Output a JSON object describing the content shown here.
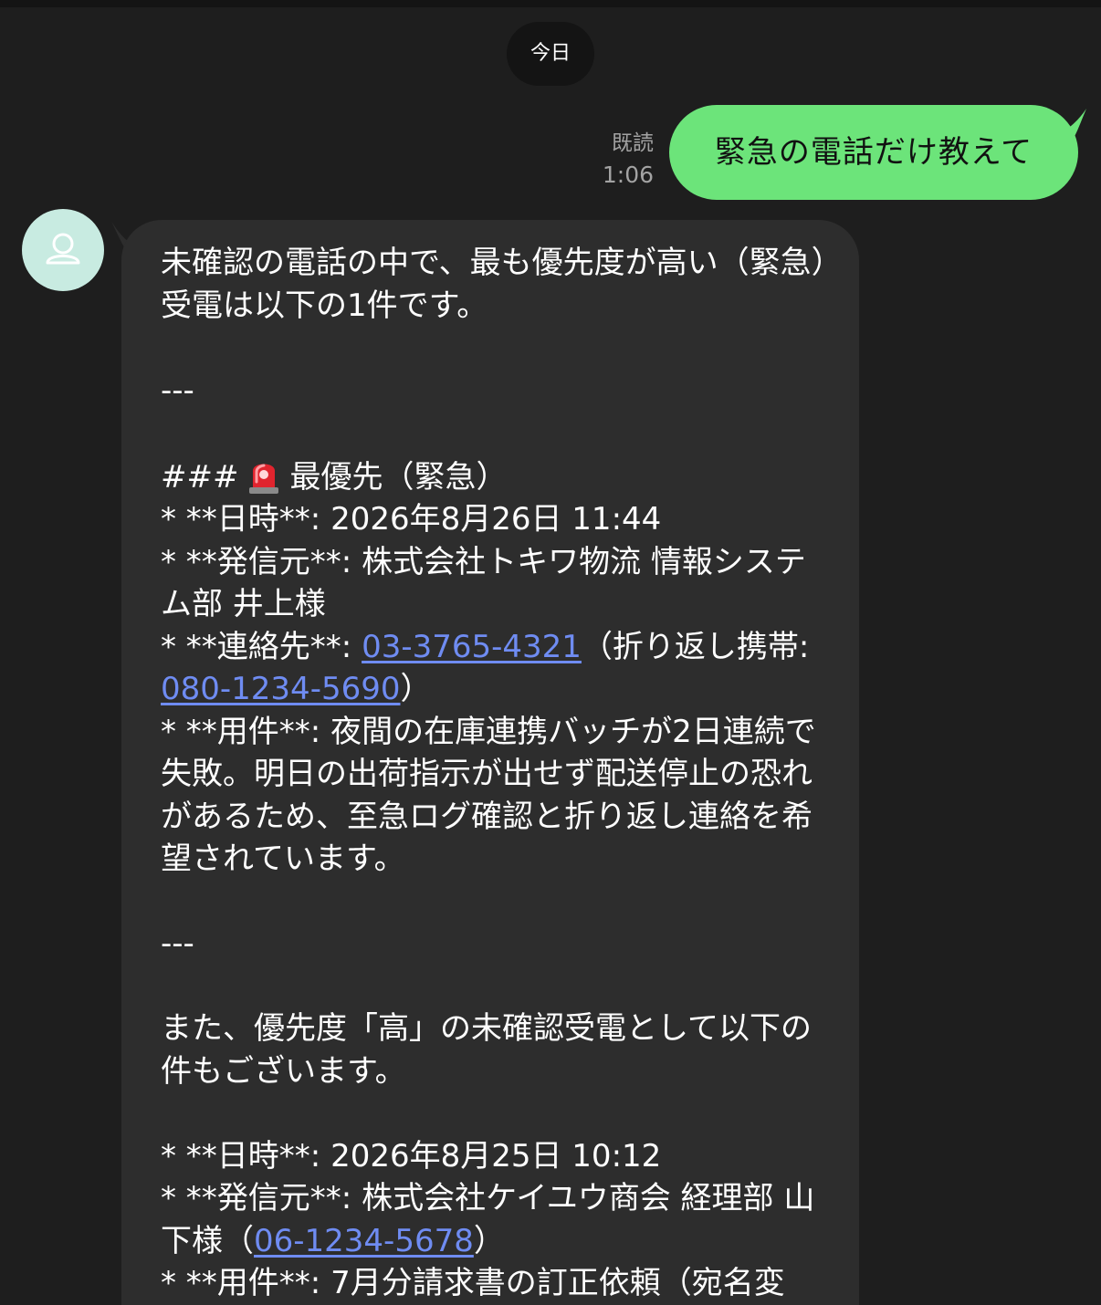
{
  "date_separator": "今日",
  "outgoing": {
    "read_label": "既読",
    "time": "1:06",
    "text": "緊急の電話だけ教えて"
  },
  "incoming": {
    "avatar_icon": "user-icon",
    "intro": "未確認の電話の中で、最も優先度が高い（緊急）受電は以下の1件です。",
    "divider_1": "---",
    "heading_prefix": "###",
    "heading_icon": "siren-icon",
    "heading_text": "最優先（緊急）",
    "urgent": {
      "datetime": "* **日時**: 2026年8月26日 11:44",
      "caller": "* **発信元**: 株式会社トキワ物流 情報システム部 井上様",
      "contact_prefix": "* **連絡先**: ",
      "contact_phone": "03-3765-4321",
      "contact_middle": "（折り返し携帯: ",
      "contact_mobile": "080-1234-5690",
      "contact_suffix": "）",
      "subject": "* **用件**: 夜間の在庫連携バッチが2日連続で失敗。明日の出荷指示が出せず配送停止の恐れがあるため、至急ログ確認と折り返し連絡を希望されています。"
    },
    "divider_2": "---",
    "also_text": "また、優先度「高」の未確認受電として以下の件もございます。",
    "high": {
      "datetime": "* **日時**: 2026年8月25日 10:12",
      "caller_prefix": "* **発信元**: 株式会社ケイユウ商会 経理部 山下様（",
      "caller_phone": "06-1234-5678",
      "caller_suffix": "）",
      "subject": "* **用件**: 7月分請求書の訂正依頼（宛名変"
    }
  },
  "colors": {
    "background": "#1e1e1e",
    "outgoing_bubble": "#6ce47a",
    "incoming_bubble": "#2d2d2d",
    "link": "#6f8cf2",
    "meta_text": "#a3a3a3",
    "avatar_bg": "#c8ebe1"
  }
}
